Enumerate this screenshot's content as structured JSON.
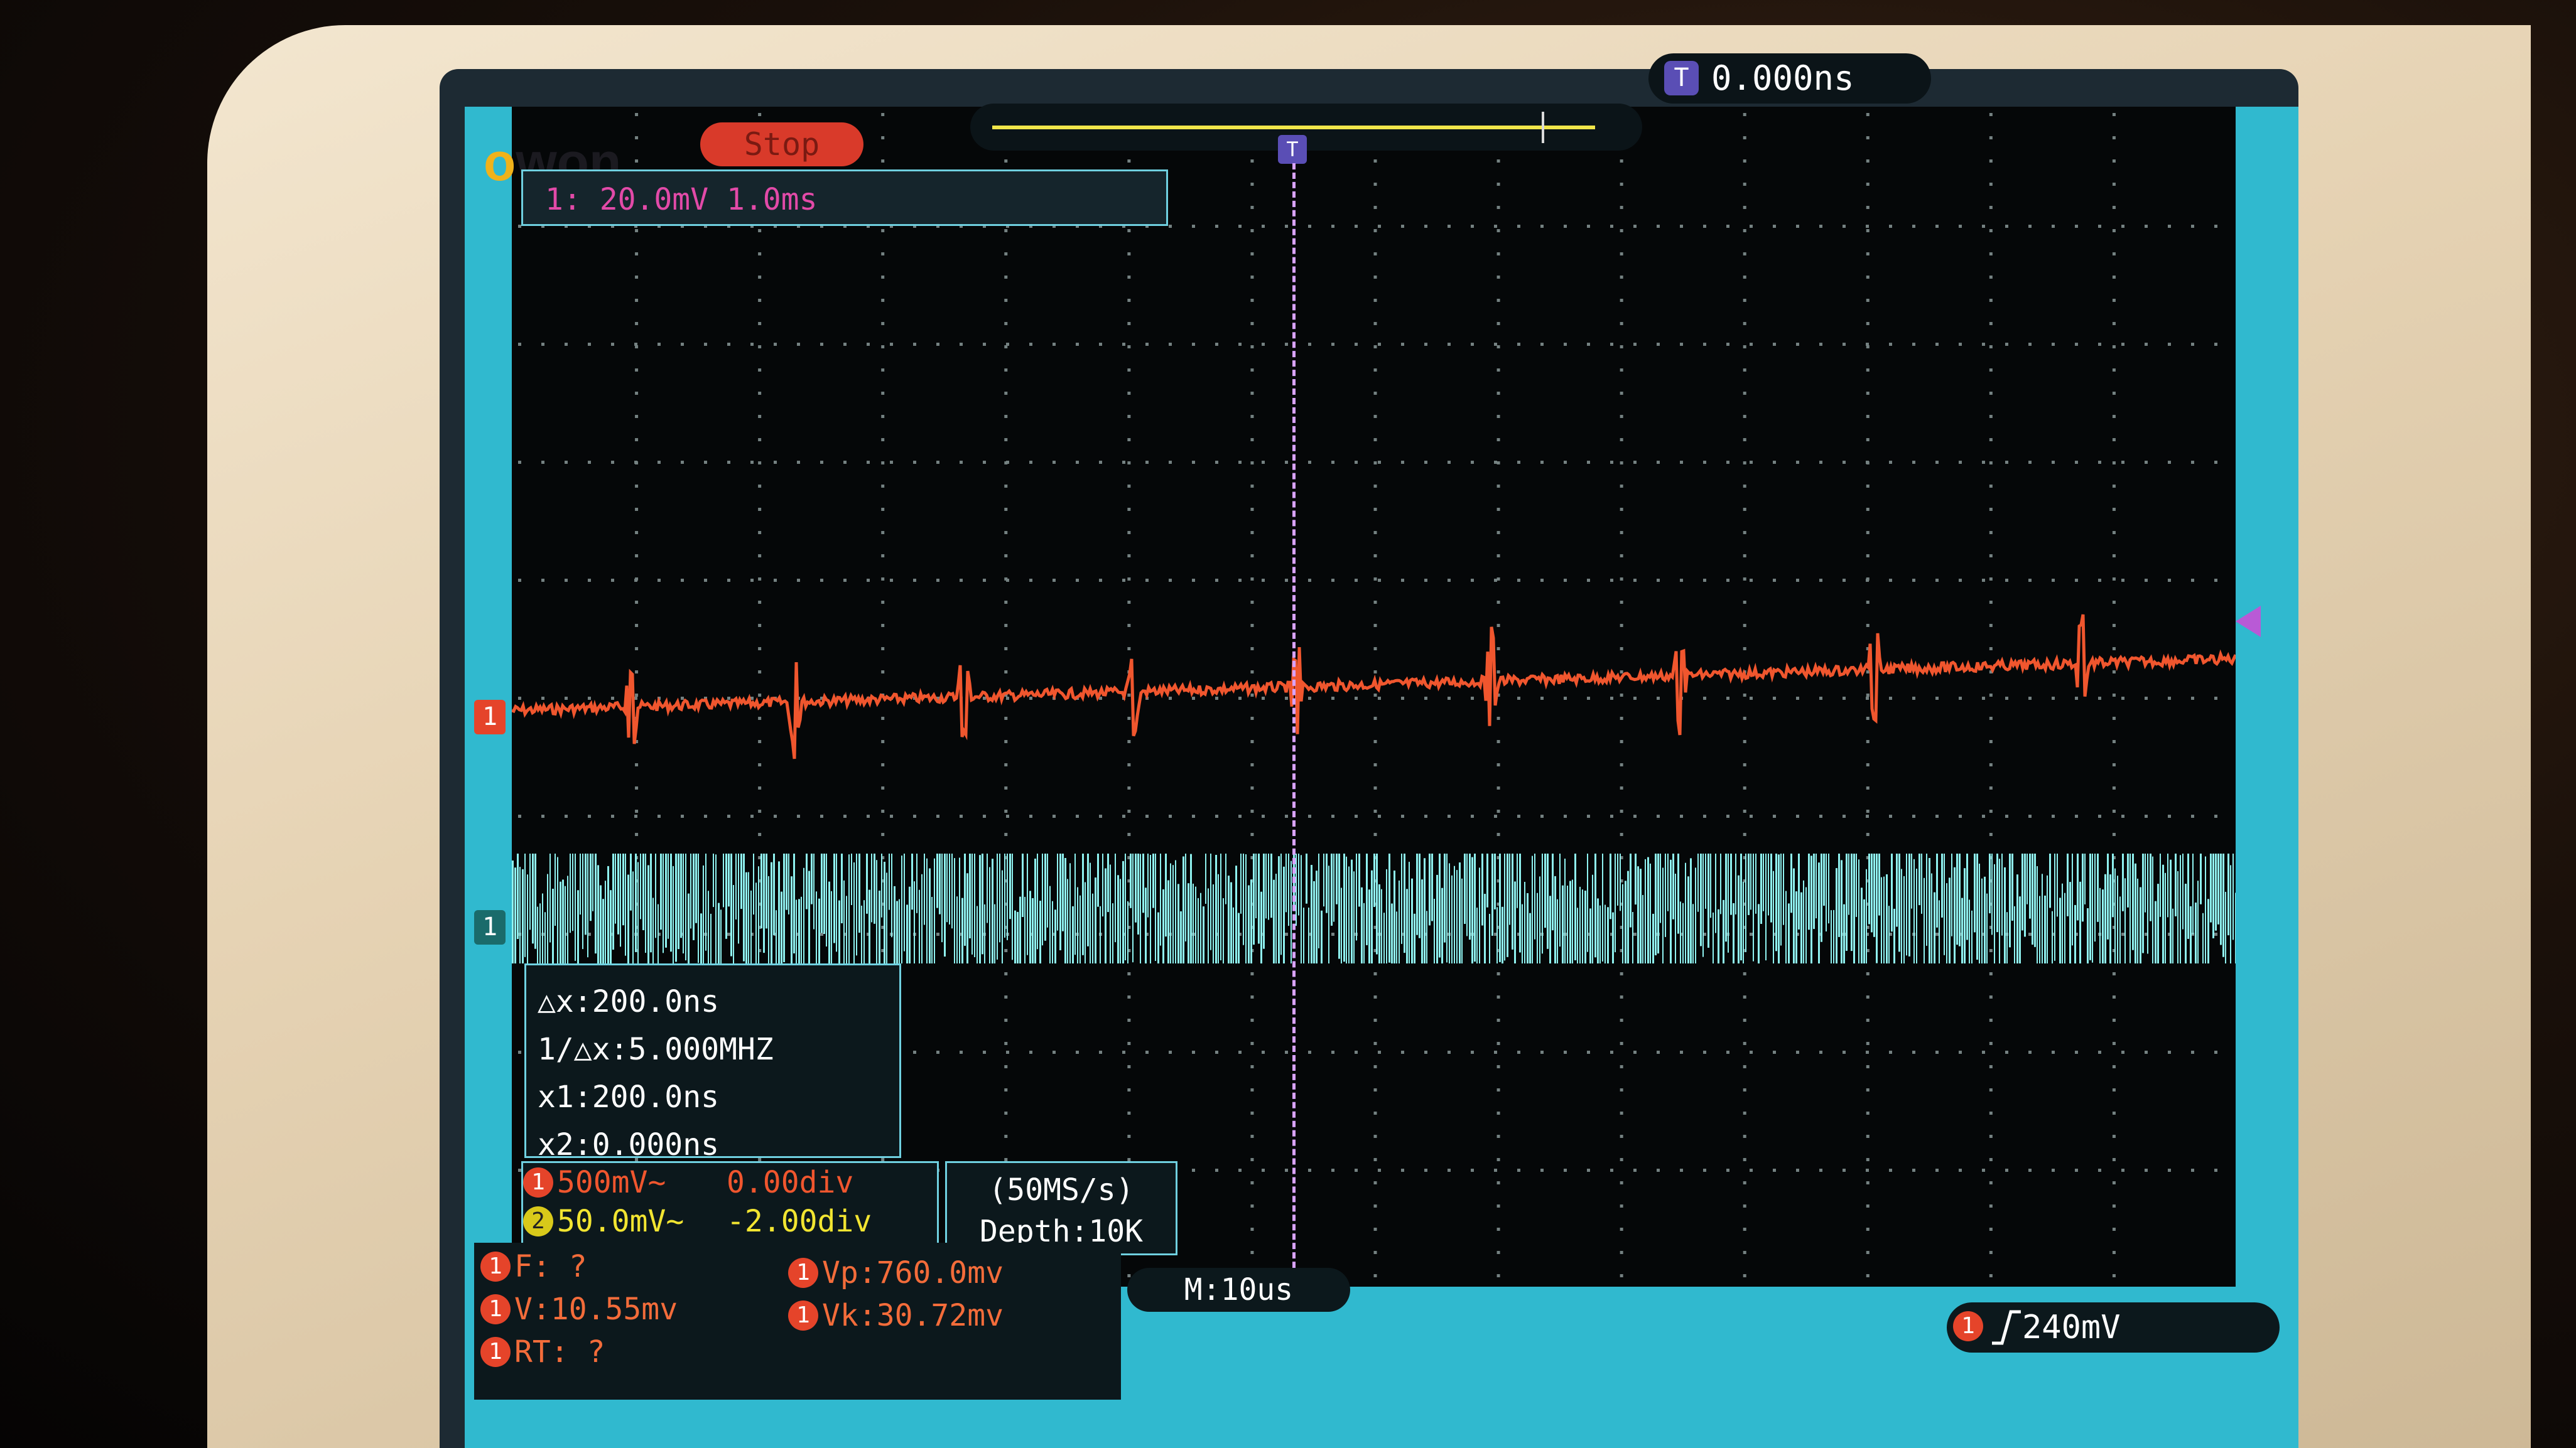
{
  "brand": {
    "logo_o": "o",
    "logo_rest": "won"
  },
  "status": {
    "run_state": "Stop"
  },
  "channel_info": {
    "text": "1: 20.0mV 1.0ms"
  },
  "trigger_position": {
    "icon": "T",
    "value": "0.000ns"
  },
  "trigger_marker": {
    "icon": "T"
  },
  "channel_markers": {
    "ch1_orange": "1",
    "ch1_cyan": "1"
  },
  "cursor_measurements": {
    "delta_x": "△x:200.0ns",
    "inverse_delta_x": "1/△x:5.000MHZ",
    "x1": "x1:200.0ns",
    "x2": "x2:0.000ns"
  },
  "channel_settings": [
    {
      "badge": "1",
      "scale": "500mV~",
      "offset": "0.00div",
      "color": "#f0562e"
    },
    {
      "badge": "2",
      "scale": "50.0mV~",
      "offset": "-2.00div",
      "color": "#f2e531"
    }
  ],
  "acquisition": {
    "sample_rate": "(50MS/s)",
    "depth": "Depth:10K"
  },
  "timebase": {
    "label": "M:10us"
  },
  "measurements": {
    "frequency": "F:  ?",
    "voltage": "V:10.55mv",
    "rise_time": "RT:  ?",
    "vpp": "Vp:760.0mv",
    "vk": "Vk:30.72mv",
    "badge": "1"
  },
  "trigger": {
    "badge": "1",
    "edge_icon": "rising-edge-icon",
    "level": "240mV"
  },
  "colors": {
    "screen": "#30b9cf",
    "ch1_orange": "#f0562e",
    "ch_cyan": "#8ff2f0",
    "trigger_purple": "#5a4eb5"
  }
}
